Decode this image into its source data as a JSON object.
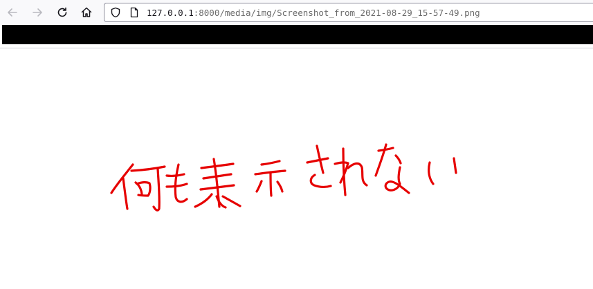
{
  "browser": {
    "url_host": "127.0.0.1",
    "url_rest": ":8000/media/img/Screenshot_from_2021-08-29_15-57-49.png",
    "icons": {
      "back": "arrow-left-icon",
      "forward": "arrow-right-icon",
      "reload": "reload-icon",
      "home": "home-icon",
      "tracking": "shield-icon",
      "page": "page-icon"
    }
  },
  "image": {
    "handwritten_text": "何も表示されない",
    "ink_color": "#e60000"
  }
}
